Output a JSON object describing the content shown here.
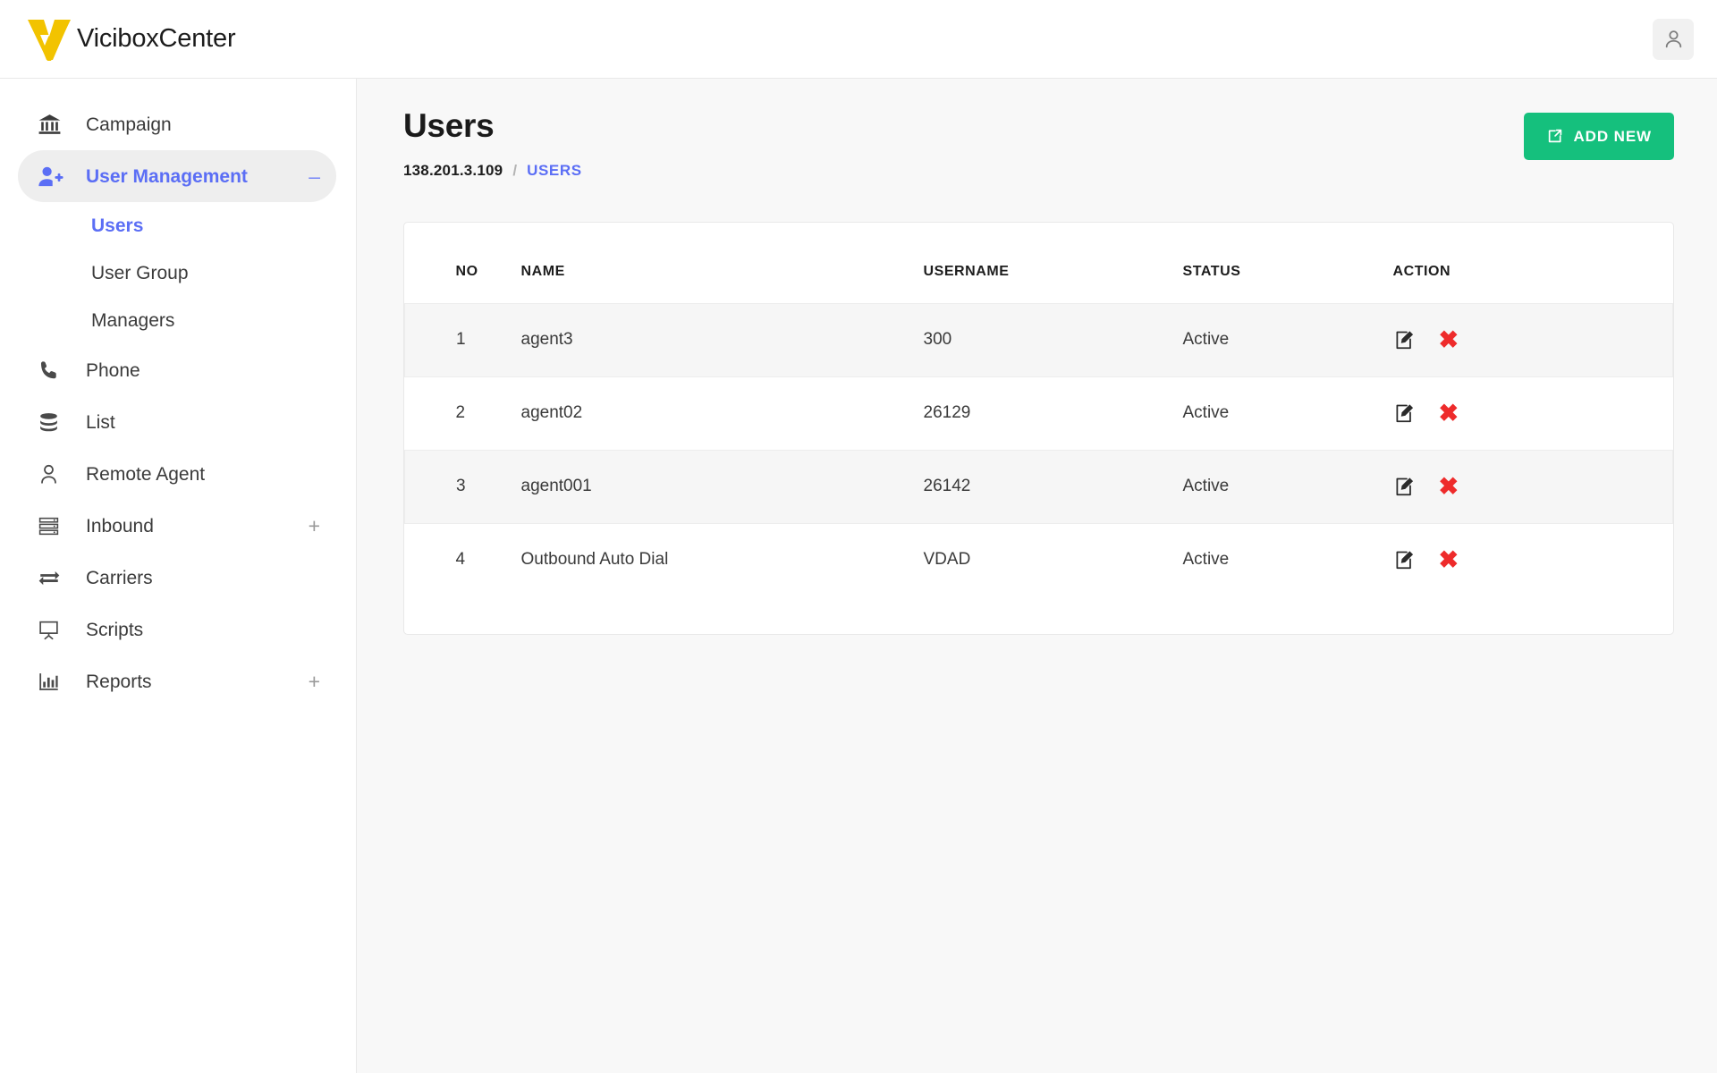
{
  "app": {
    "brand_name": "ViciboxCenter",
    "logo_color": "#F2C300",
    "accent_color": "#5b6ef5",
    "success_color": "#15c07d",
    "danger_color": "#ee2b2b",
    "avatar_icon": "user-icon"
  },
  "sidebar": {
    "items": [
      {
        "label": "Campaign",
        "icon": "bank-icon",
        "active": false,
        "toggle": ""
      },
      {
        "label": "User Management",
        "icon": "user-add-icon",
        "active": true,
        "toggle": "–"
      },
      {
        "label": "Phone",
        "icon": "phone-icon",
        "active": false,
        "toggle": ""
      },
      {
        "label": "List",
        "icon": "database-icon",
        "active": false,
        "toggle": ""
      },
      {
        "label": "Remote Agent",
        "icon": "person-icon",
        "active": false,
        "toggle": ""
      },
      {
        "label": "Inbound",
        "icon": "server-list-icon",
        "active": false,
        "toggle": "+"
      },
      {
        "label": "Carriers",
        "icon": "exchange-icon",
        "active": false,
        "toggle": ""
      },
      {
        "label": "Scripts",
        "icon": "whiteboard-icon",
        "active": false,
        "toggle": ""
      },
      {
        "label": "Reports",
        "icon": "bar-chart-icon",
        "active": false,
        "toggle": "+"
      }
    ],
    "subitems": [
      {
        "label": "Users",
        "active": true
      },
      {
        "label": "User Group",
        "active": false
      },
      {
        "label": "Managers",
        "active": false
      }
    ]
  },
  "page": {
    "title": "Users",
    "breadcrumb": {
      "host": "138.201.3.109",
      "separator": "/",
      "current": "USERS"
    },
    "add_button": {
      "label": "ADD NEW",
      "icon": "external-link-icon"
    }
  },
  "table": {
    "headers": [
      "NO",
      "NAME",
      "USERNAME",
      "STATUS",
      "ACTION"
    ],
    "rows": [
      {
        "no": "1",
        "name": "agent3",
        "username": "300",
        "status": "Active"
      },
      {
        "no": "2",
        "name": "agent02",
        "username": "26129",
        "status": "Active"
      },
      {
        "no": "3",
        "name": "agent001",
        "username": "26142",
        "status": "Active"
      },
      {
        "no": "4",
        "name": "Outbound Auto Dial",
        "username": "VDAD",
        "status": "Active"
      }
    ],
    "actions": {
      "edit_icon": "edit-pencil-icon",
      "delete_icon": "delete-x-icon",
      "delete_glyph": "✖"
    }
  }
}
